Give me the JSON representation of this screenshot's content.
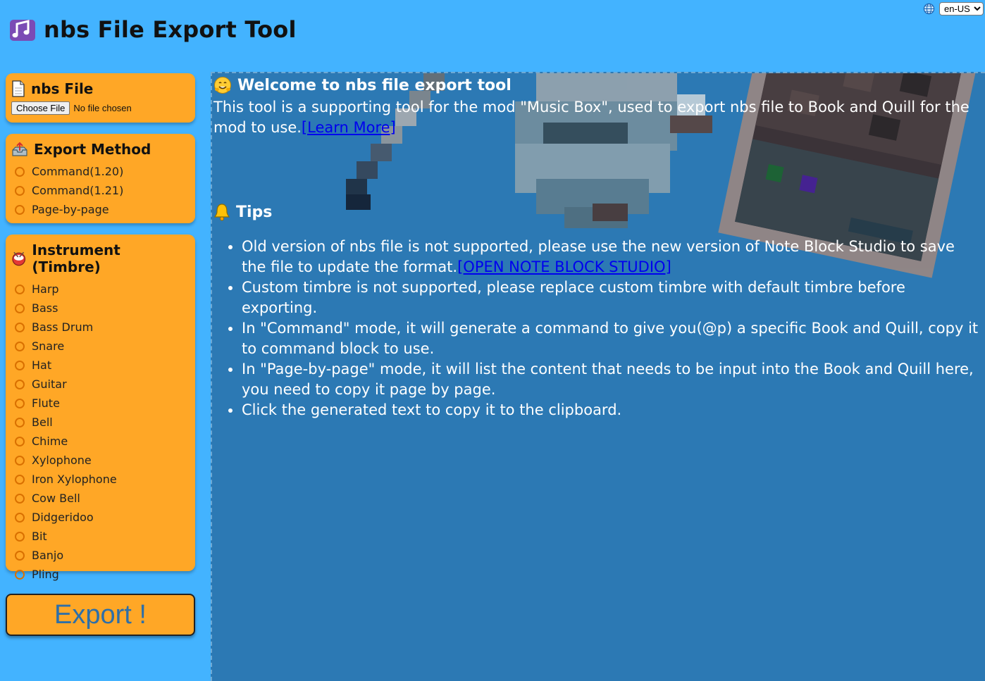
{
  "header": {
    "title": "nbs File Export Tool",
    "logo_icon": "music-note-icon"
  },
  "language": {
    "icon": "globe-icon",
    "selected": "en-US"
  },
  "file_panel": {
    "title": "nbs File",
    "icon": "document-icon",
    "choose_button": "Choose File",
    "status": "No file chosen"
  },
  "export_method": {
    "title": "Export Method",
    "icon": "outbox-tray-icon",
    "options": [
      "Command(1.20)",
      "Command(1.21)",
      "Page-by-page"
    ]
  },
  "instrument": {
    "title": "Instrument (Timbre)",
    "icon": "drum-icon",
    "options": [
      "Harp",
      "Bass",
      "Bass Drum",
      "Snare",
      "Hat",
      "Guitar",
      "Flute",
      "Bell",
      "Chime",
      "Xylophone",
      "Iron Xylophone",
      "Cow Bell",
      "Didgeridoo",
      "Bit",
      "Banjo",
      "Pling"
    ]
  },
  "export_button": "Export !",
  "welcome": {
    "icon": "hugging-face-icon",
    "title": "Welcome to nbs file export tool",
    "text": "This tool is a supporting tool for the mod \"Music Box\", used to export nbs file to Book and Quill for the mod to use.",
    "link": "[Learn More]"
  },
  "tips": {
    "icon": "bell-icon",
    "title": "Tips",
    "items": [
      {
        "text": "Old version of nbs file is not supported, please use the new version of Note Block Studio to save the file to update the format.",
        "link": "[OPEN NOTE BLOCK STUDIO]"
      },
      {
        "text": "Custom timbre is not supported, please replace custom timbre with default timbre before exporting.",
        "link": ""
      },
      {
        "text": "In \"Command\" mode, it will generate a command to give you(@p) a specific Book and Quill, copy it to command block to use.",
        "link": ""
      },
      {
        "text": "In \"Page-by-page\" mode, it will list the content that needs to be input into the Book and Quill here, you need to copy it page by page.",
        "link": ""
      },
      {
        "text": "Click the generated text to copy it to the clipboard.",
        "link": ""
      }
    ]
  },
  "colors": {
    "background": "#43b3ff",
    "panel": "#ffa726",
    "main": "#2c79b4",
    "link": "#0000ee"
  }
}
